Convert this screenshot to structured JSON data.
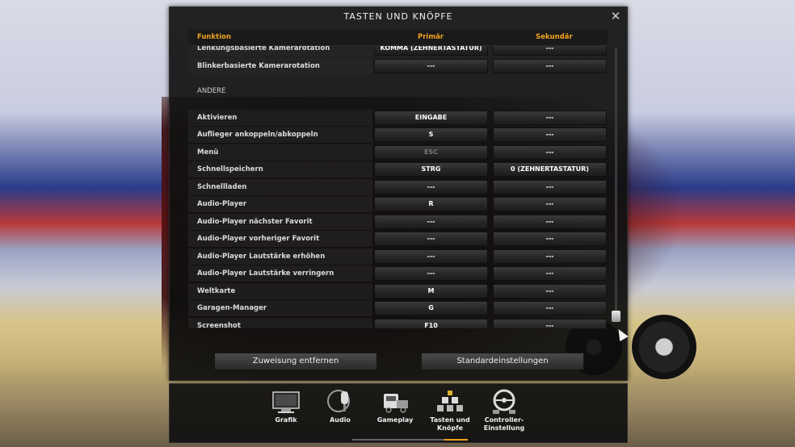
{
  "window": {
    "title": "TASTEN UND KNÖPFE",
    "close_icon": "close-icon"
  },
  "table": {
    "columns": [
      "Funktion",
      "Primär",
      "Sekundär"
    ],
    "rows": [
      {
        "label": "Lenkungsbasierte Kamerarotation",
        "primary": "KOMMA (ZEHNERTASTATUR)",
        "secondary": "---"
      },
      {
        "label": "Blinkerbasierte Kamerarotation",
        "primary": "---",
        "secondary": "---"
      },
      {
        "section": "ANDERE"
      },
      {
        "label": "Aktivieren",
        "primary": "EINGABE",
        "secondary": "---"
      },
      {
        "label": "Auflieger ankoppeln/abkoppeln",
        "primary": "S",
        "secondary": "---"
      },
      {
        "label": "Menü",
        "primary": "ESC",
        "secondary": "---",
        "primary_dim": true
      },
      {
        "label": "Schnellspeichern",
        "primary": "STRG",
        "secondary": "0 (ZEHNERTASTATUR)"
      },
      {
        "label": "Schnellladen",
        "primary": "---",
        "secondary": "---"
      },
      {
        "label": "Audio-Player",
        "primary": "R",
        "secondary": "---"
      },
      {
        "label": "Audio-Player nächster Favorit",
        "primary": "---",
        "secondary": "---"
      },
      {
        "label": "Audio-Player vorheriger Favorit",
        "primary": "---",
        "secondary": "---"
      },
      {
        "label": "Audio-Player Lautstärke erhöhen",
        "primary": "---",
        "secondary": "---"
      },
      {
        "label": "Audio-Player Lautstärke verringern",
        "primary": "---",
        "secondary": "---"
      },
      {
        "label": "Weltkarte",
        "primary": "M",
        "secondary": "---"
      },
      {
        "label": "Garagen-Manager",
        "primary": "G",
        "secondary": "---"
      },
      {
        "label": "Screenshot",
        "primary": "F10",
        "secondary": "---"
      }
    ]
  },
  "buttons": {
    "remove": "Zuweisung entfernen",
    "defaults": "Standardeinstellungen"
  },
  "dock": {
    "items": [
      {
        "label": "Grafik",
        "icon": "monitor-icon"
      },
      {
        "label": "Audio",
        "icon": "microphone-icon"
      },
      {
        "label": "Gameplay",
        "icon": "truck-icon"
      },
      {
        "label": "Tasten und Knöpfe",
        "icon": "keyboard-icon",
        "active": true
      },
      {
        "label": "Controller-Einstellung",
        "icon": "steering-wheel-icon"
      }
    ]
  },
  "colors": {
    "accent": "#f0a21e",
    "panel": "#141414",
    "key_button": "#2c2c2c"
  }
}
